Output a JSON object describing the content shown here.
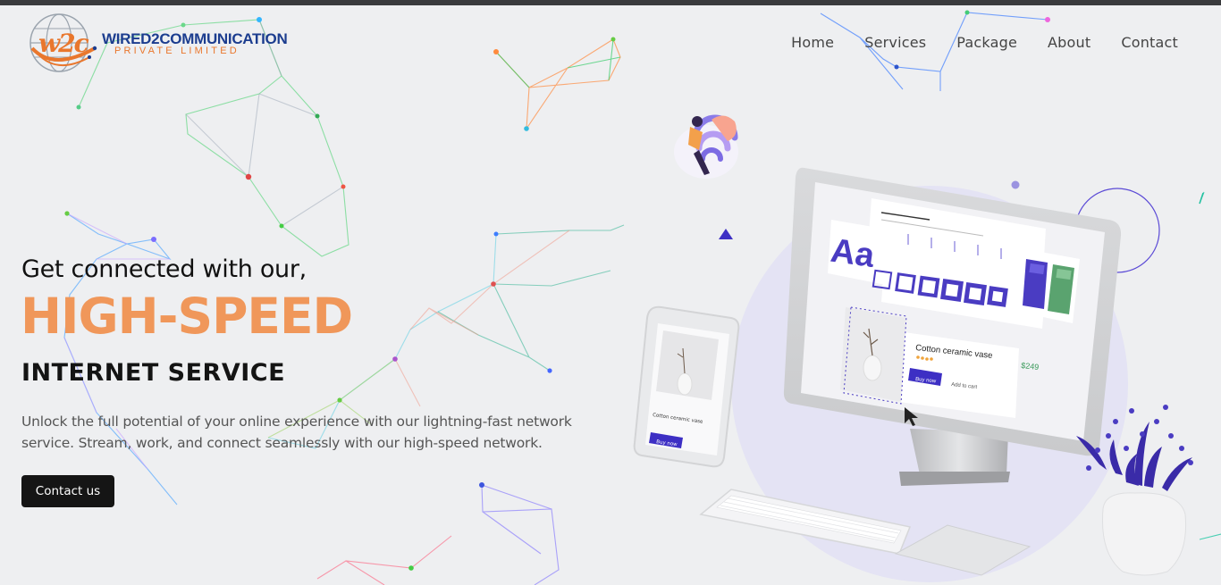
{
  "brand": {
    "title": "WIRED2COMMUNICATION",
    "subtitle": "PRIVATE LIMITED",
    "mark": "w2c",
    "colors": {
      "navy": "#1c3d8f",
      "orange": "#e9772d"
    }
  },
  "nav": {
    "items": [
      {
        "label": "Home"
      },
      {
        "label": "Services"
      },
      {
        "label": "Package"
      },
      {
        "label": "About"
      },
      {
        "label": "Contact"
      }
    ]
  },
  "hero": {
    "line1": "Get connected with our,",
    "line2": "HIGH-SPEED",
    "line3": "INTERNET SERVICE",
    "description": "Unlock the full potential of your online experience with our lightning-fast network service. Stream, work, and connect seamlessly with our high-speed network.",
    "cta_label": "Contact us",
    "accent_color": "#f0975a"
  },
  "illustration": {
    "aa_label": "Aa",
    "product_name": "Cotton ceramic vase",
    "price": "$249",
    "buy_label": "Buy now",
    "cart_label": "Add to cart",
    "phone_product": "Cotton ceramic vase",
    "phone_buy_label": "Buy now",
    "icons": [
      "wifi-person-icon",
      "triangle-icon",
      "cursor-icon"
    ]
  }
}
